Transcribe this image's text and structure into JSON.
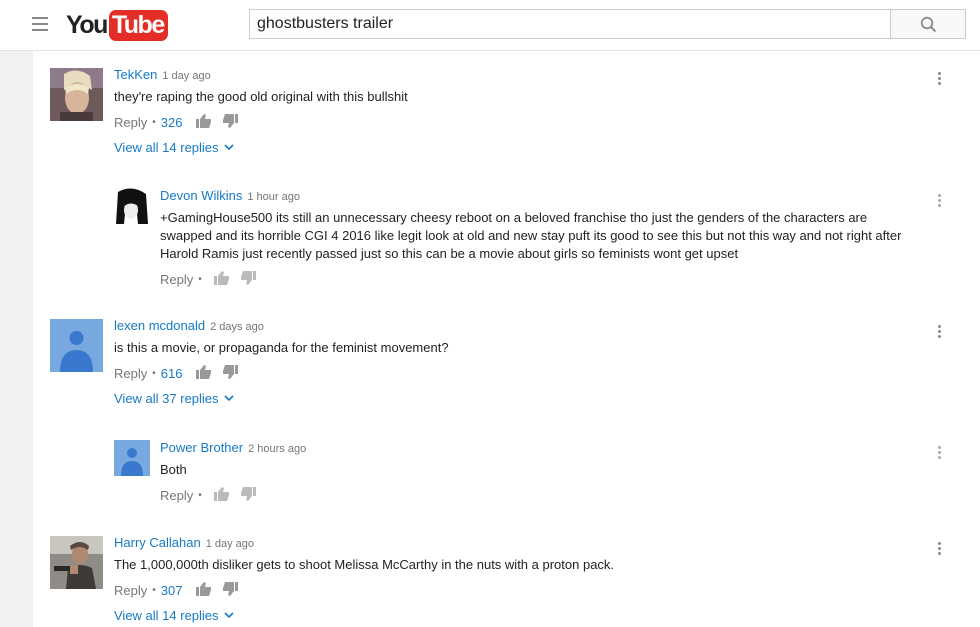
{
  "header": {
    "logo_you": "You",
    "logo_tube": "Tube",
    "search_value": "ghostbusters trailer"
  },
  "comments": [
    {
      "author": "TekKen",
      "time": "1 day ago",
      "text": "they're raping the good old original with this bullshit",
      "reply_label": "Reply",
      "likes": "326",
      "view_all": "View all 14 replies",
      "avatar_icon": "tekken-avatar"
    },
    {
      "author": "Devon Wilkins",
      "time": "1 hour ago",
      "text": "+GamingHouse500 its still an unnecessary cheesy reboot on a beloved franchise tho just the genders of the characters are swapped and its horrible CGI 4 2016 like legit look at old and new stay puft its good to see this but not this way and not right after Harold Ramis just recently passed just so this can be a movie about girls so feminists wont get upset",
      "reply_label": "Reply",
      "avatar_icon": "anime-avatar"
    },
    {
      "author": "lexen mcdonald",
      "time": "2 days ago",
      "text": "is this a movie, or propaganda for the feminist movement?",
      "reply_label": "Reply",
      "likes": "616",
      "view_all": "View all 37 replies",
      "avatar_icon": "default-user-avatar"
    },
    {
      "author": "Power Brother",
      "time": "2 hours ago",
      "text": "Both",
      "reply_label": "Reply",
      "avatar_icon": "default-user-avatar"
    },
    {
      "author": "Harry Callahan",
      "time": "1 day ago",
      "text": "The 1,000,000th disliker gets to shoot Melissa McCarthy in the nuts with a proton pack.",
      "reply_label": "Reply",
      "likes": "307",
      "view_all": "View all 14 replies",
      "avatar_icon": "man-with-gun-avatar"
    }
  ],
  "colors": {
    "link_blue": "#167ac6",
    "youtube_red": "#e52d27",
    "default_avatar": "#78a8e0"
  }
}
